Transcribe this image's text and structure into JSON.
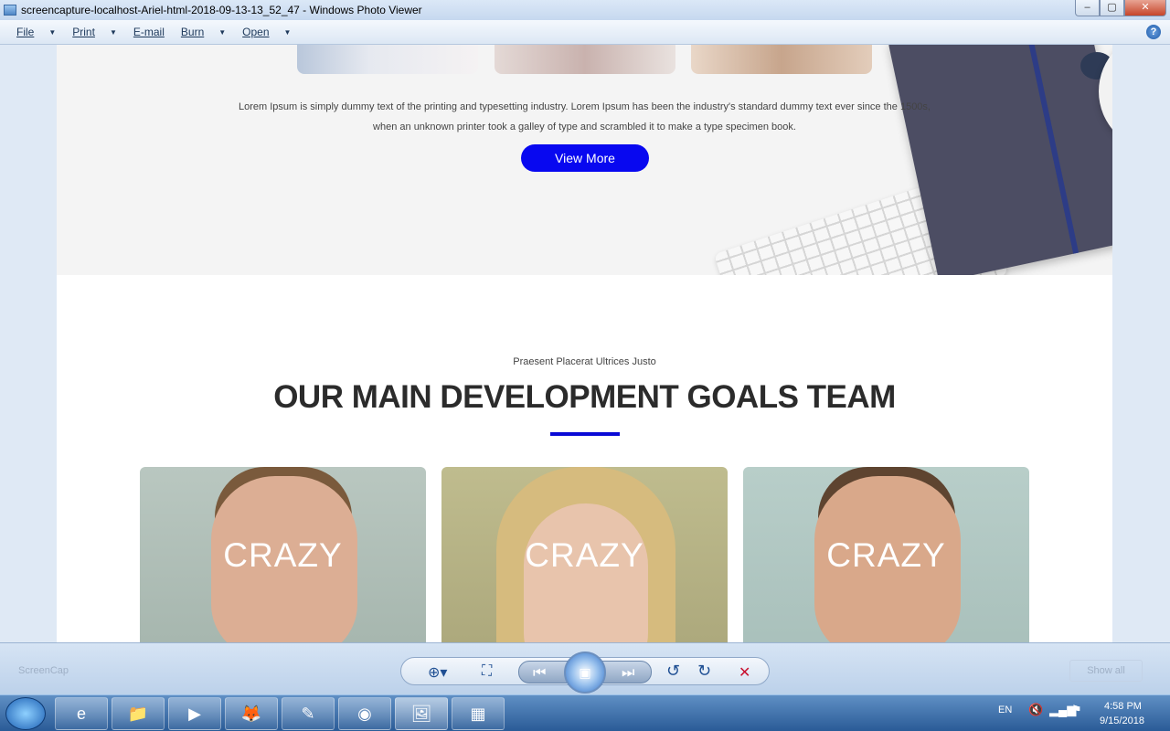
{
  "window": {
    "title": "screencapture-localhost-Ariel-html-2018-09-13-13_52_47 - Windows Photo Viewer",
    "controls": {
      "minimize": "‒",
      "maximize": "▢",
      "close": "✕"
    }
  },
  "menubar": {
    "items": [
      {
        "label": "File",
        "caret": "▼"
      },
      {
        "label": "Print",
        "caret": "▼"
      },
      {
        "label": "E-mail",
        "caret": ""
      },
      {
        "label": "Burn",
        "caret": "▼"
      },
      {
        "label": "Open",
        "caret": "▼"
      }
    ],
    "help": "?"
  },
  "webpage": {
    "hero": {
      "text": "Lorem Ipsum is simply dummy text of the printing and typesetting industry. Lorem Ipsum has been the industry's standard dummy text ever since the 1500s, when an unknown printer took a galley of type and scrambled it to make a type specimen book.",
      "button": "View More"
    },
    "team": {
      "eyebrow": "Praesent Placerat Ultrices Justo",
      "title": "OUR MAIN DEVELOPMENT GOALS TEAM",
      "accent_color": "#0a0ad6",
      "cards": [
        {
          "label": "CRAZY"
        },
        {
          "label": "CRAZY"
        },
        {
          "label": "CRAZY"
        }
      ]
    }
  },
  "viewer_controls": {
    "zoom": "⊕▾",
    "fit": "⛶",
    "previous": "⏮",
    "slideshow": "▣",
    "next": "⏭",
    "rotate_left": "↺",
    "rotate_right": "↻",
    "delete": "✕",
    "ghost_left": "ScreenCap",
    "ghost_right": "Show all"
  },
  "taskbar": {
    "apps": [
      "e",
      "📁",
      "▶",
      "🦊",
      "✎",
      "◉",
      "🖼",
      "▦"
    ],
    "tray": {
      "language": "EN",
      "time": "4:58 PM",
      "date": "9/15/2018"
    }
  },
  "colors": {
    "button_blue": "#0808f0",
    "accent_blue": "#0a0ad6"
  }
}
